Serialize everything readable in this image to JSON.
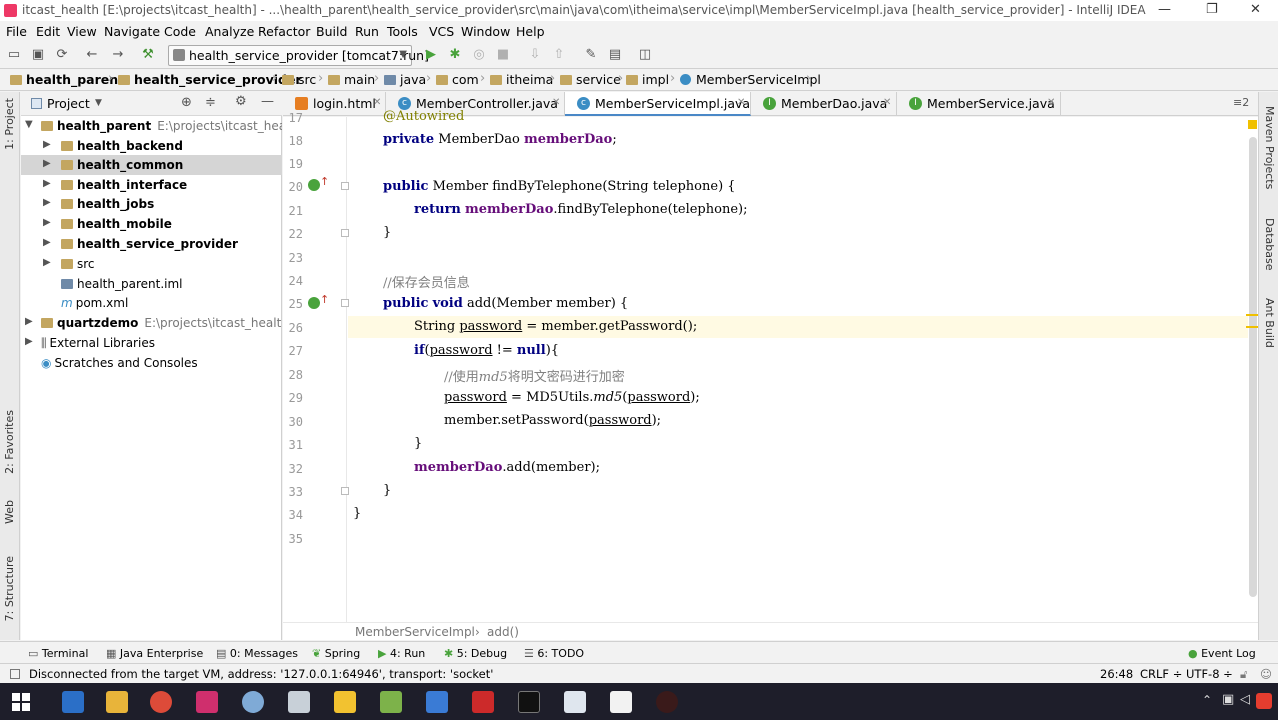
{
  "window": {
    "title": "itcast_health [E:\\projects\\itcast_health] - ...\\health_parent\\health_service_provider\\src\\main\\java\\com\\itheima\\service\\impl\\MemberServiceImpl.java [health_service_provider] - IntelliJ IDEA",
    "minimize": "—",
    "maximize": "❐",
    "close": "✕"
  },
  "menu": [
    "File",
    "Edit",
    "View",
    "Navigate",
    "Code",
    "Analyze",
    "Refactor",
    "Build",
    "Run",
    "Tools",
    "VCS",
    "Window",
    "Help"
  ],
  "toolbar": {
    "run_config": "health_service_provider [tomcat7:run]"
  },
  "breadcrumb": [
    "health_parent",
    "health_service_provider",
    "src",
    "main",
    "java",
    "com",
    "itheima",
    "service",
    "impl",
    "MemberServiceImpl"
  ],
  "project_panel": {
    "title": "Project",
    "tree": [
      {
        "name": "health_parent",
        "path": "E:\\projects\\itcast_health\\h",
        "bold": true,
        "expanded": true
      },
      {
        "name": "health_backend",
        "bold": true
      },
      {
        "name": "health_common",
        "bold": true,
        "selected": true
      },
      {
        "name": "health_interface",
        "bold": true
      },
      {
        "name": "health_jobs",
        "bold": true
      },
      {
        "name": "health_mobile",
        "bold": true
      },
      {
        "name": "health_service_provider",
        "bold": true
      },
      {
        "name": "src"
      },
      {
        "name": "health_parent.iml"
      },
      {
        "name": "pom.xml"
      },
      {
        "name": "quartzdemo",
        "path": "E:\\projects\\itcast_health\\qu",
        "bold": true
      },
      {
        "name": "External Libraries"
      },
      {
        "name": "Scratches and Consoles"
      }
    ]
  },
  "left_tool_tabs": [
    "1: Project",
    "2: Favorites",
    "Web",
    "7: Structure"
  ],
  "right_tool_tabs": [
    "Maven Projects",
    "Database",
    "Ant Build"
  ],
  "editor_tabs": [
    {
      "label": "login.html",
      "active": false
    },
    {
      "label": "MemberController.java",
      "active": false
    },
    {
      "label": "MemberServiceImpl.java",
      "active": true
    },
    {
      "label": "MemberDao.java",
      "active": false
    },
    {
      "label": "MemberService.java",
      "active": false
    }
  ],
  "tab_overflow": "≡2",
  "code": {
    "partial_line": "@Autowired",
    "line_numbers": [
      "17",
      "18",
      "19",
      "20",
      "21",
      "22",
      "23",
      "24",
      "25",
      "26",
      "27",
      "28",
      "29",
      "30",
      "31",
      "32",
      "33",
      "34",
      "35"
    ],
    "l18_kw": "private",
    "l18_type": " MemberDao ",
    "l18_fld": "memberDao",
    "l18_end": ";",
    "l20_kw": "public",
    "l20_rest": " Member findByTelephone(String telephone) {",
    "l21_kw": "return",
    "l21_fld": "memberDao",
    "l21_rest": ".findByTelephone(telephone);",
    "l22": "}",
    "l24": "//保存会员信息",
    "l25_kw1": "public",
    "l25_kw2": "void",
    "l25_rest": " add(Member member) {",
    "l26_a": "String ",
    "l26_var": "password",
    "l26_b": " = member.getPassword();",
    "l27_kw": "if",
    "l27_a": "(",
    "l27_var": "password",
    "l27_b": " != ",
    "l27_kw2": "null",
    "l27_c": "){",
    "l28_a": "//使用",
    "l28_it": "md5",
    "l28_b": "将明文密码进行加密",
    "l29_var": "password",
    "l29_a": " = MD5Utils.",
    "l29_it": "md5",
    "l29_b": "(",
    "l29_var2": "password",
    "l29_c": ");",
    "l30_a": "member.setPassword(",
    "l30_var": "password",
    "l30_b": ");",
    "l31": "}",
    "l32_fld": "memberDao",
    "l32_rest": ".add(member);",
    "l33": "}",
    "l34": "}"
  },
  "editor_breadcrumb": [
    "MemberServiceImpl",
    "add()"
  ],
  "bottom_tools": {
    "terminal": "Terminal",
    "java_enterprise": "Java Enterprise",
    "messages": "0: Messages",
    "spring": "Spring",
    "run": "4: Run",
    "debug": "5: Debug",
    "todo": "6: TODO",
    "event_log": "Event Log"
  },
  "status": {
    "message": "Disconnected from the target VM, address: '127.0.0.1:64946', transport: 'socket'",
    "position": "26:48",
    "line_sep": "CRLF ÷",
    "encoding": "UTF-8 ÷"
  },
  "colors": {
    "keyword": "#000080",
    "field": "#660e7a",
    "comment": "#808080",
    "caret_row": "#fffae3",
    "tab_underline": "#4a88c7"
  }
}
